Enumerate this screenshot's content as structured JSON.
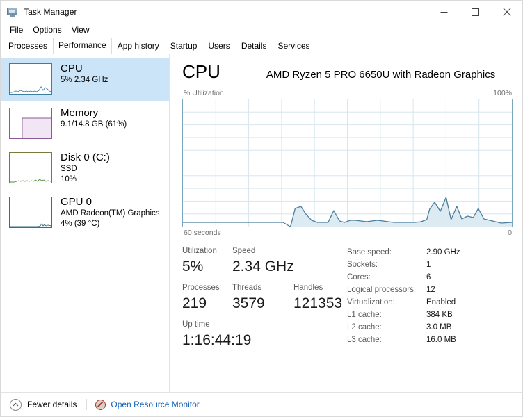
{
  "window": {
    "title": "Task Manager",
    "icon": "task-manager-icon",
    "buttons": {
      "minimize": "–",
      "maximize": "□",
      "close": "✕"
    }
  },
  "menubar": {
    "items": [
      "File",
      "Options",
      "View"
    ]
  },
  "tabs": {
    "items": [
      {
        "label": "Processes",
        "active": false
      },
      {
        "label": "Performance",
        "active": true
      },
      {
        "label": "App history",
        "active": false
      },
      {
        "label": "Startup",
        "active": false
      },
      {
        "label": "Users",
        "active": false
      },
      {
        "label": "Details",
        "active": false
      },
      {
        "label": "Services",
        "active": false
      }
    ]
  },
  "sidebar": {
    "items": [
      {
        "title": "CPU",
        "sub1": "5%  2.34 GHz",
        "sub2": "",
        "selected": true,
        "color": "#3b7f9c"
      },
      {
        "title": "Memory",
        "sub1": "9.1/14.8 GB (61%)",
        "sub2": "",
        "selected": false,
        "color": "#8a5b96"
      },
      {
        "title": "Disk 0 (C:)",
        "sub1": "SSD",
        "sub2": "10%",
        "selected": false,
        "color": "#7a7a3d"
      },
      {
        "title": "GPU 0",
        "sub1": "AMD Radeon(TM) Graphics",
        "sub2": "4%  (39 °C)",
        "selected": false,
        "color": "#3a6e86"
      }
    ]
  },
  "main": {
    "heading": "CPU",
    "model": "AMD Ryzen 5 PRO 6650U with Radeon Graphics",
    "graph": {
      "y_label": "% Utilization",
      "y_max_label": "100%",
      "x_left_label": "60 seconds",
      "x_right_label": "0",
      "line_color": "#4a7f9e",
      "fill_color": "#dceaf2",
      "grid_color": "#d7e6ef"
    },
    "stats": {
      "utilization_label": "Utilization",
      "utilization_value": "5%",
      "speed_label": "Speed",
      "speed_value": "2.34 GHz",
      "processes_label": "Processes",
      "processes_value": "219",
      "threads_label": "Threads",
      "threads_value": "3579",
      "handles_label": "Handles",
      "handles_value": "121353",
      "uptime_label": "Up time",
      "uptime_value": "1:16:44:19"
    },
    "specs": [
      {
        "label": "Base speed:",
        "value": "2.90 GHz"
      },
      {
        "label": "Sockets:",
        "value": "1"
      },
      {
        "label": "Cores:",
        "value": "6"
      },
      {
        "label": "Logical processors:",
        "value": "12"
      },
      {
        "label": "Virtualization:",
        "value": "Enabled"
      },
      {
        "label": "L1 cache:",
        "value": "384 KB"
      },
      {
        "label": "L2 cache:",
        "value": "3.0 MB"
      },
      {
        "label": "L3 cache:",
        "value": "16.0 MB"
      }
    ]
  },
  "statusbar": {
    "fewer_details": "Fewer details",
    "resource_monitor": "Open Resource Monitor",
    "link_color": "#1763b6"
  },
  "chart_data": {
    "type": "area",
    "title": "% Utilization",
    "xlabel": "60 seconds",
    "ylabel": "% Utilization",
    "ylim": [
      0,
      100
    ],
    "xlim": [
      60,
      0
    ],
    "grid": true,
    "grid_columns": 10,
    "grid_rows": 10,
    "series": [
      {
        "name": "CPU utilization",
        "color": "#4a7f9e",
        "values": [
          0,
          0,
          0,
          0,
          0,
          0,
          0,
          0,
          0,
          0,
          0,
          0,
          0,
          0,
          0,
          0,
          0,
          0,
          0,
          0,
          1,
          14,
          15,
          10,
          5,
          3,
          3,
          3,
          3,
          10,
          4,
          3,
          3,
          4,
          5,
          4,
          3,
          4,
          5,
          4,
          3,
          3,
          4,
          3,
          3,
          3,
          3,
          3,
          3,
          14,
          19,
          12,
          23,
          5,
          16,
          6,
          8,
          7,
          14,
          6,
          5
        ]
      }
    ],
    "sidebar_thumbnails": [
      {
        "name": "CPU",
        "type": "line",
        "color": "#3b7f9c"
      },
      {
        "name": "Memory",
        "type": "area",
        "color": "#8a5b96",
        "fill_percent": 61
      },
      {
        "name": "Disk",
        "type": "line",
        "color": "#4f8a3c"
      },
      {
        "name": "GPU",
        "type": "line",
        "color": "#3a6e86"
      }
    ]
  }
}
